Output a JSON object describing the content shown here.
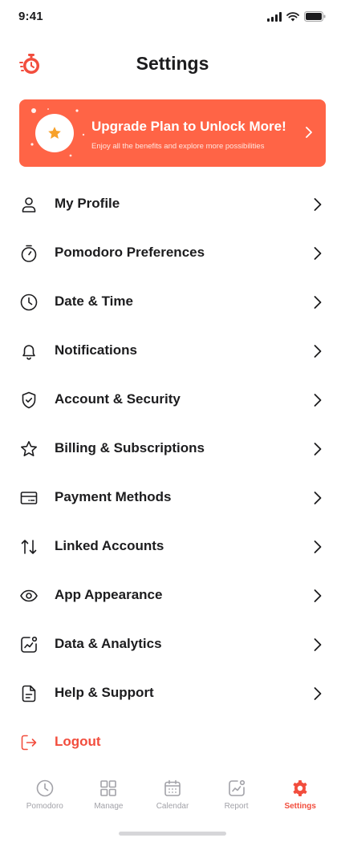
{
  "status_bar": {
    "time": "9:41"
  },
  "header": {
    "title": "Settings",
    "logo_icon": "stopwatch-logo-icon"
  },
  "banner": {
    "title": "Upgrade Plan to Unlock More!",
    "subtitle": "Enjoy all the benefits and explore more possibilities",
    "icon": "star-icon"
  },
  "settings": {
    "items": [
      {
        "label": "My Profile",
        "icon": "user-icon"
      },
      {
        "label": "Pomodoro Preferences",
        "icon": "timer-icon"
      },
      {
        "label": "Date & Time",
        "icon": "clock-icon"
      },
      {
        "label": "Notifications",
        "icon": "bell-icon"
      },
      {
        "label": "Account & Security",
        "icon": "shield-icon"
      },
      {
        "label": "Billing & Subscriptions",
        "icon": "star-outline-icon"
      },
      {
        "label": "Payment Methods",
        "icon": "card-icon"
      },
      {
        "label": "Linked Accounts",
        "icon": "arrows-updown-icon"
      },
      {
        "label": "App Appearance",
        "icon": "eye-icon"
      },
      {
        "label": "Data & Analytics",
        "icon": "chart-icon"
      },
      {
        "label": "Help & Support",
        "icon": "document-icon"
      }
    ],
    "logout": {
      "label": "Logout",
      "icon": "logout-icon"
    }
  },
  "tab_bar": {
    "tabs": [
      {
        "label": "Pomodoro",
        "icon": "clock-icon",
        "active": false
      },
      {
        "label": "Manage",
        "icon": "grid-icon",
        "active": false
      },
      {
        "label": "Calendar",
        "icon": "calendar-icon",
        "active": false
      },
      {
        "label": "Report",
        "icon": "chart-icon",
        "active": false
      },
      {
        "label": "Settings",
        "icon": "gear-icon",
        "active": true
      }
    ]
  },
  "colors": {
    "accent": "#ff6446",
    "danger": "#f24d3d",
    "text": "#1c1c1e",
    "muted": "#a2a2a8"
  }
}
